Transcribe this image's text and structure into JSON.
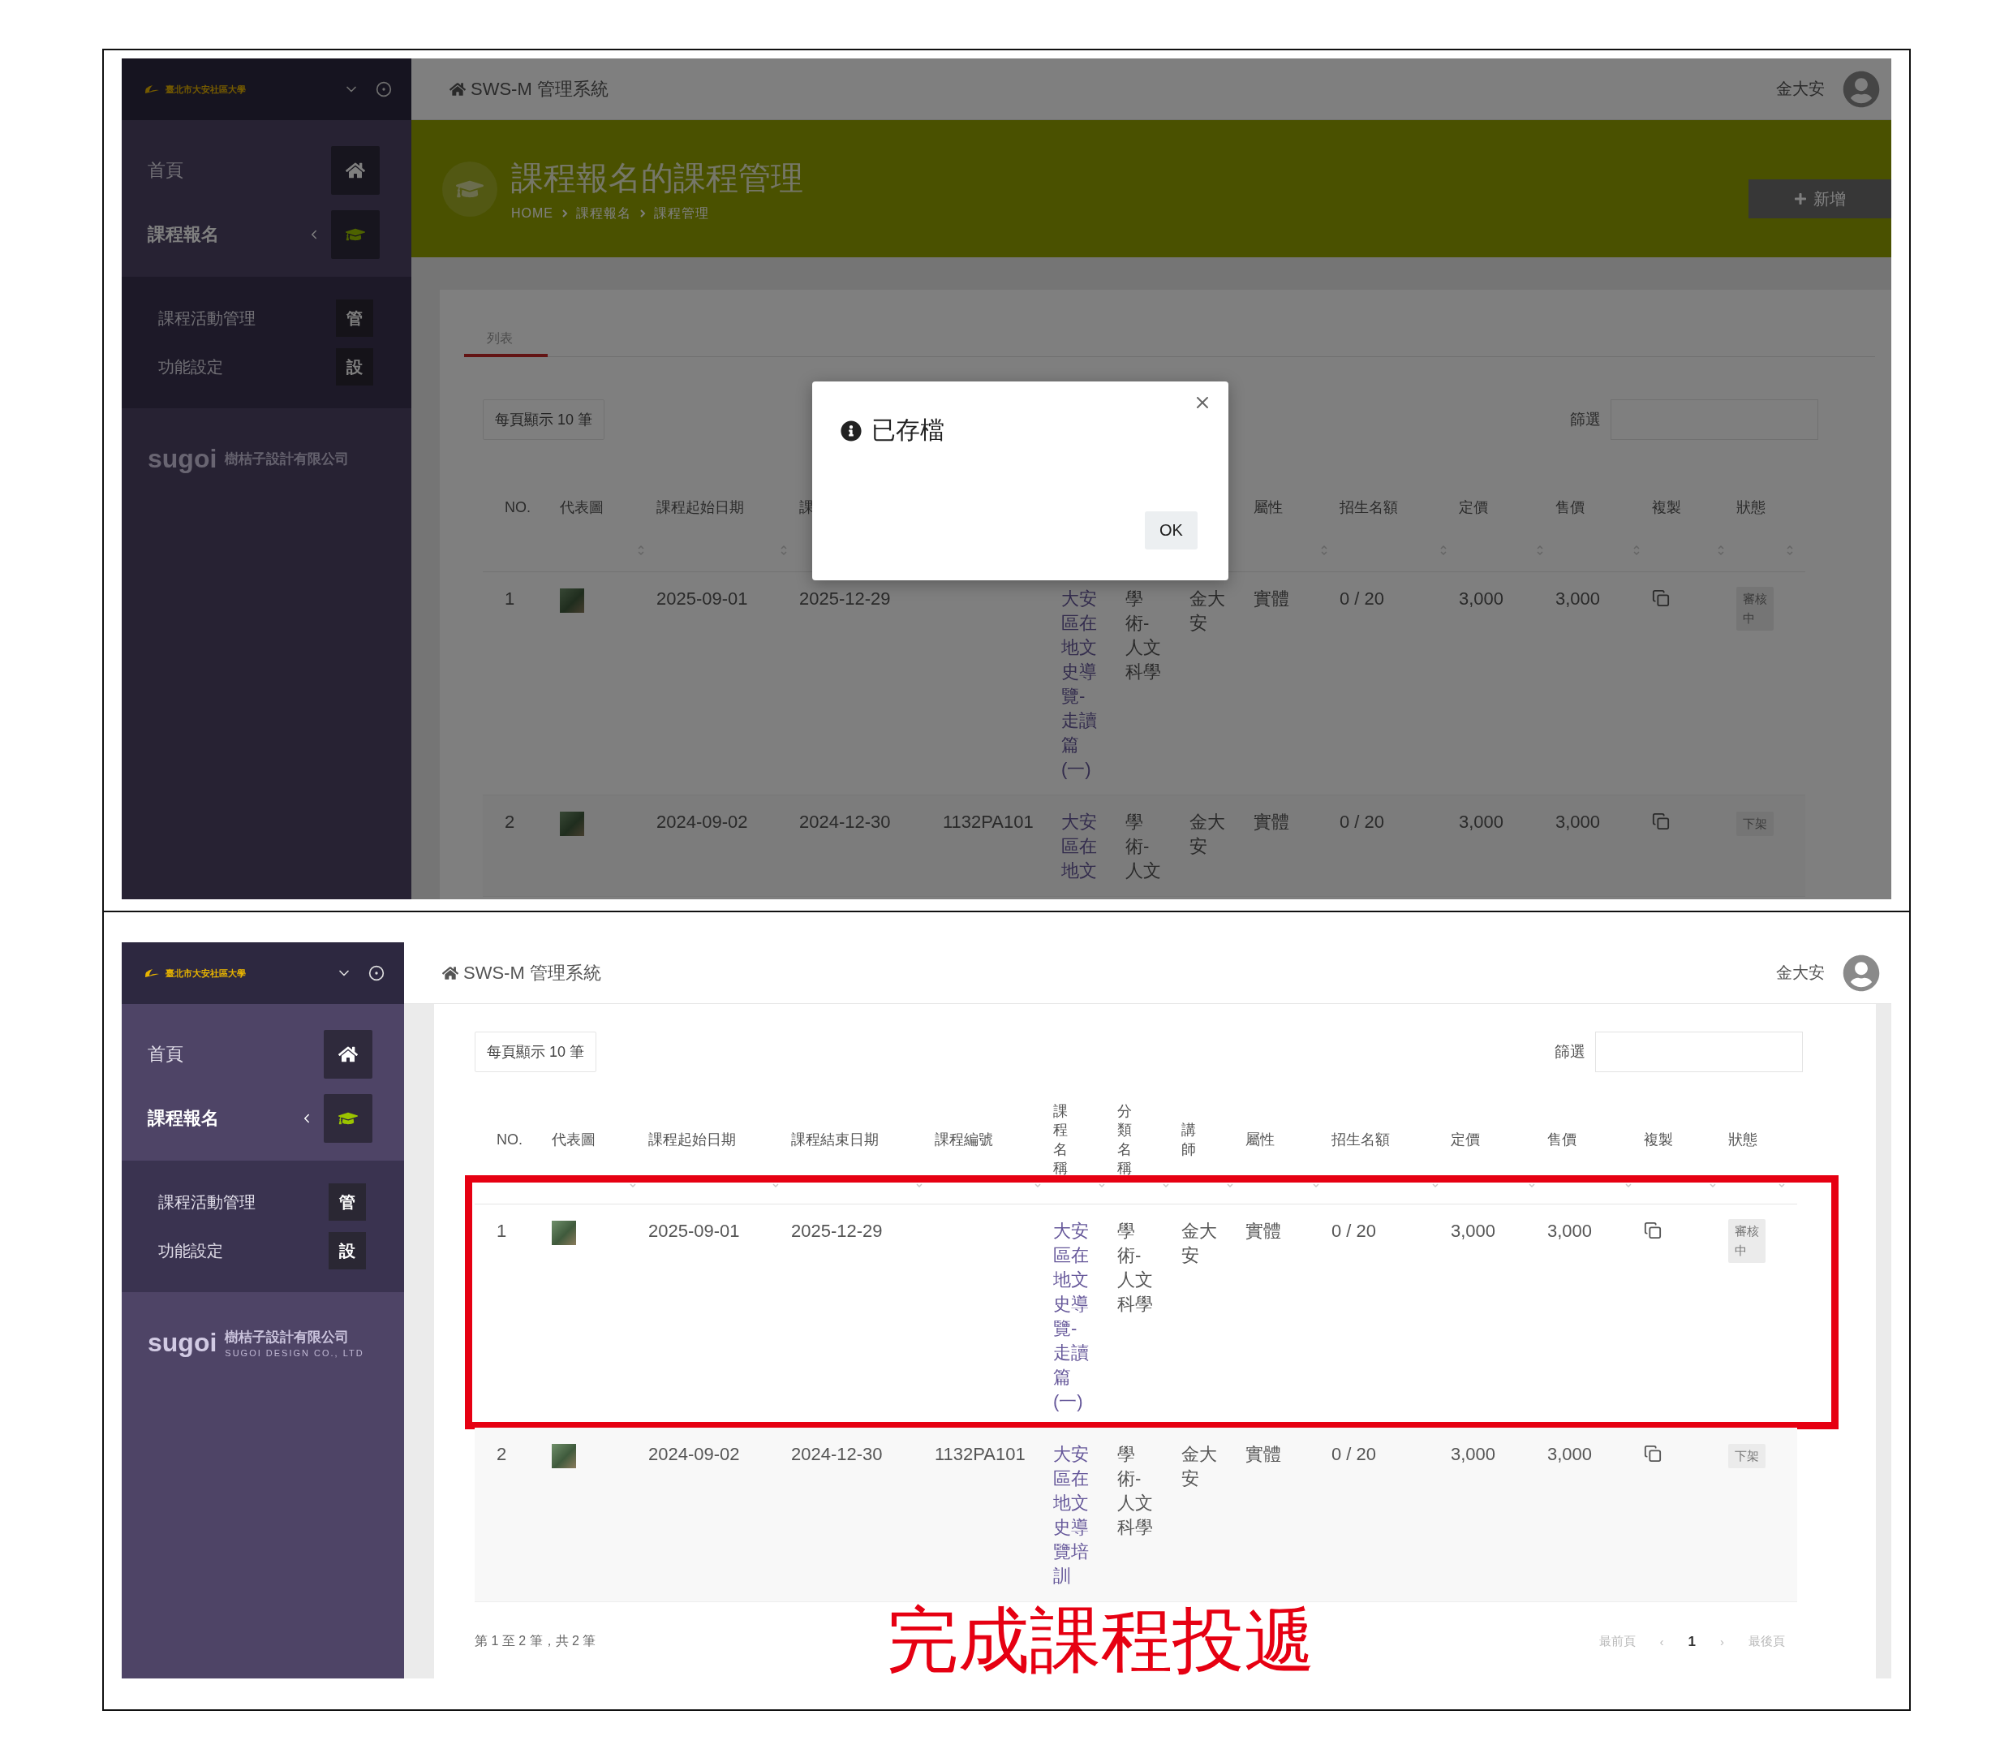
{
  "screens": [
    {
      "sidebar": {
        "logo": "臺北市大安社區大學",
        "items": [
          {
            "label": "首頁",
            "kind": "home",
            "selected": false
          },
          {
            "label": "課程報名",
            "kind": "cap",
            "selected": true,
            "expanded": true,
            "children": [
              {
                "label": "課程活動管理",
                "badge": "管",
                "selected": false
              },
              {
                "label": "功能設定",
                "badge": "設",
                "selected": false
              }
            ]
          }
        ],
        "brand": {
          "name": "sugoi",
          "company": "樹桔子設計有限公司"
        }
      },
      "topbar": {
        "title": "SWS-M 管理系統",
        "user": "金大安"
      },
      "banner": {
        "title": "課程報名的課程管理",
        "breadcrumbs": [
          "HOME",
          "課程報名",
          "課程管理"
        ],
        "button": "新增"
      },
      "tabs": [
        {
          "label": "列表",
          "selected": true
        }
      ],
      "page_size": "每頁顯示 10 筆",
      "filter": {
        "label": "篩選"
      },
      "table": {
        "columns": [
          {
            "label": "NO.",
            "kind": "wide",
            "sortable": false
          },
          {
            "label": "代表圖",
            "kind": "wide",
            "sortable": true
          },
          {
            "label": "課程起始日期",
            "kind": "wide",
            "sortable": true
          },
          {
            "label": "課",
            "kind": "wide"
          },
          {},
          {},
          {},
          {},
          {
            "label": "屬性",
            "kind": "wide",
            "sortable": true
          },
          {
            "label": "招生名額",
            "kind": "wide",
            "sortable": true
          },
          {
            "label": "定價",
            "kind": "wide",
            "sortable": true
          },
          {
            "label": "售價",
            "kind": "wide",
            "sortable": true
          },
          {
            "label": "複製",
            "kind": "wide",
            "sortable": true
          },
          {
            "label": "狀態",
            "kind": "wide",
            "sortable": true
          }
        ],
        "rows": [
          {
            "no": "1",
            "start_date": "2025-09-01",
            "end_date": "2025-12-29",
            "name": "大安區在地文史導覽-走讀篇(一)",
            "category": "學術-人文科學",
            "teacher": "金大安",
            "type": "實體",
            "quota": "0 / 20",
            "price": "3,000",
            "sale_price": "3,000",
            "status": "審核中"
          },
          {
            "no": "2",
            "start_date": "2024-09-02",
            "end_date": "2024-12-30",
            "code": "1132PA101",
            "name": "大安區在地文",
            "category": "學術-人文",
            "teacher": "金大安",
            "type": "實體",
            "quota": "0 / 20",
            "price": "3,000",
            "sale_price": "3,000",
            "status": "下架"
          }
        ]
      },
      "dialog": {
        "title": "已存檔",
        "button": "OK"
      }
    },
    {
      "sidebar": {
        "logo": "臺北市大安社區大學",
        "items": [
          {
            "label": "首頁",
            "kind": "home",
            "selected": false
          },
          {
            "label": "課程報名",
            "kind": "cap",
            "selected": true,
            "expanded": true,
            "children": [
              {
                "label": "課程活動管理",
                "badge": "管",
                "selected": false
              },
              {
                "label": "功能設定",
                "badge": "設",
                "selected": false
              }
            ]
          }
        ],
        "brand": {
          "name": "sugoi",
          "company": "樹桔子設計有限公司",
          "tagline": "SUGOI DESIGN CO., LTD"
        }
      },
      "topbar": {
        "title": "SWS-M 管理系統",
        "user": "金大安"
      },
      "page_size": "每頁顯示 10 筆",
      "filter": {
        "label": "篩選"
      },
      "table": {
        "columns": [
          {
            "label": "NO.",
            "kind": "wide",
            "sortable": false
          },
          {
            "label": "代表圖",
            "kind": "wide",
            "sortable": true
          },
          {
            "label": "課程起始日期",
            "kind": "wide",
            "sortable": true
          },
          {
            "label": "課程結束日期",
            "kind": "wide",
            "sortable": true
          },
          {
            "label": "課程編號",
            "kind": "wide",
            "sortable": true
          },
          {
            "label": "課程名稱",
            "kind": "narrow",
            "sortable": true
          },
          {
            "label": "分類名稱",
            "kind": "narrow",
            "sortable": true
          },
          {
            "label": "講師",
            "kind": "narrow",
            "sortable": true
          },
          {
            "label": "屬性",
            "kind": "wide",
            "sortable": true
          },
          {
            "label": "招生名額",
            "kind": "wide",
            "sortable": true
          },
          {
            "label": "定價",
            "kind": "wide",
            "sortable": true
          },
          {
            "label": "售價",
            "kind": "wide",
            "sortable": true
          },
          {
            "label": "複製",
            "kind": "wide",
            "sortable": true
          },
          {
            "label": "狀態",
            "kind": "wide",
            "sortable": true
          }
        ],
        "rows": [
          {
            "no": "1",
            "start_date": "2025-09-01",
            "end_date": "2025-12-29",
            "name": "大安區在地文史導覽-走讀篇(一)",
            "category": "學術-人文科學",
            "teacher": "金大安",
            "type": "實體",
            "quota": "0 / 20",
            "price": "3,000",
            "sale_price": "3,000",
            "status": "審核中",
            "highlighted": true
          },
          {
            "no": "2",
            "start_date": "2024-09-02",
            "end_date": "2024-12-30",
            "code": "1132PA101",
            "name": "大安區在地文史導覽培訓",
            "category": "學術-人文科學",
            "teacher": "金大安",
            "type": "實體",
            "quota": "0 / 20",
            "price": "3,000",
            "sale_price": "3,000",
            "status": "下架",
            "highlighted": false
          }
        ]
      },
      "footer": {
        "summary": "第 1 至 2 筆，共 2 筆",
        "pagination": [
          {
            "label": "最前頁",
            "selected": false
          },
          {
            "label": "‹",
            "selected": false
          },
          {
            "label": "1",
            "selected": true
          },
          {
            "label": "›",
            "selected": false
          },
          {
            "label": "最後頁",
            "selected": false
          }
        ]
      },
      "caption": "完成課程投遞"
    }
  ]
}
